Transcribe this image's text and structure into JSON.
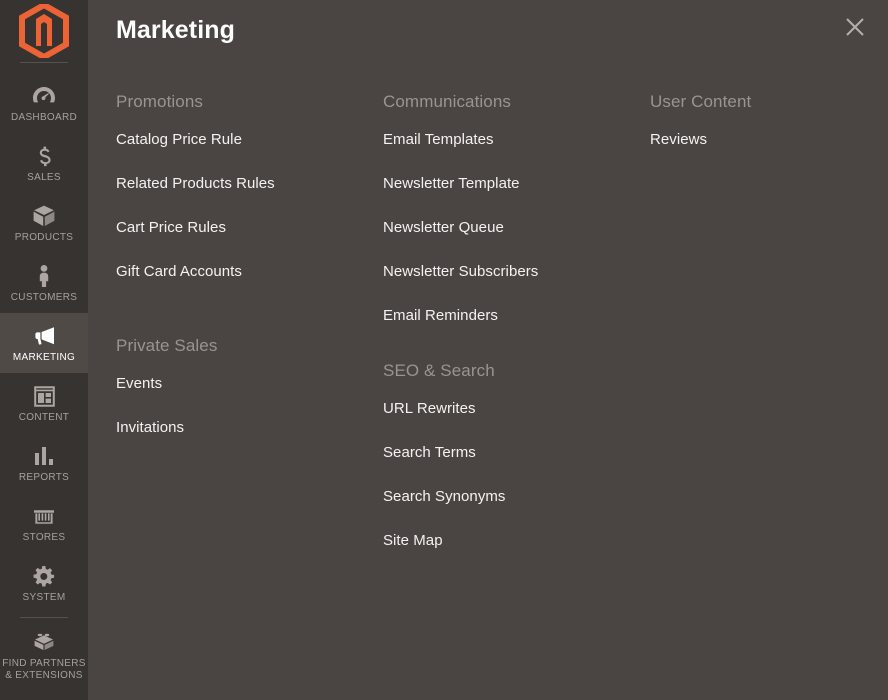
{
  "brand": {
    "logo_icon": "magento-logo-icon",
    "logo_color": "#ec6335"
  },
  "sidebar": {
    "items": [
      {
        "label": "DASHBOARD",
        "icon": "dashboard-gauge-icon",
        "active": false
      },
      {
        "label": "SALES",
        "icon": "dollar-sign-icon",
        "active": false
      },
      {
        "label": "PRODUCTS",
        "icon": "box-icon",
        "active": false
      },
      {
        "label": "CUSTOMERS",
        "icon": "person-icon",
        "active": false
      },
      {
        "label": "MARKETING",
        "icon": "megaphone-icon",
        "active": true
      },
      {
        "label": "CONTENT",
        "icon": "layout-page-icon",
        "active": false
      },
      {
        "label": "REPORTS",
        "icon": "bar-chart-icon",
        "active": false
      },
      {
        "label": "STORES",
        "icon": "storefront-icon",
        "active": false
      },
      {
        "label": "SYSTEM",
        "icon": "gear-icon",
        "active": false
      }
    ],
    "footer_item": {
      "label_line1": "FIND PARTNERS",
      "label_line2": "& EXTENSIONS",
      "icon": "lego-brick-icon"
    }
  },
  "panel": {
    "title": "Marketing",
    "close_icon": "close-x-icon",
    "columns": [
      {
        "groups": [
          {
            "title": "Promotions",
            "items": [
              "Catalog Price Rule",
              "Related Products Rules",
              "Cart Price Rules",
              "Gift Card Accounts"
            ]
          },
          {
            "title": "Private Sales",
            "items": [
              "Events",
              "Invitations"
            ]
          }
        ]
      },
      {
        "groups": [
          {
            "title": "Communications",
            "items": [
              "Email Templates",
              "Newsletter Template",
              "Newsletter Queue",
              "Newsletter Subscribers",
              "Email Reminders"
            ]
          },
          {
            "title": "SEO & Search",
            "items": [
              "URL Rewrites",
              "Search Terms",
              "Search Synonyms",
              "Site Map"
            ]
          }
        ]
      },
      {
        "groups": [
          {
            "title": "User Content",
            "items": [
              "Reviews"
            ]
          }
        ]
      }
    ]
  },
  "colors": {
    "sidebar_bg": "#373330",
    "panel_bg": "#4a4542",
    "active_item_bg": "#4f4a46",
    "accent_orange": "#ec6335",
    "group_title": "#9b938f",
    "link_text": "#f4f2f1"
  }
}
